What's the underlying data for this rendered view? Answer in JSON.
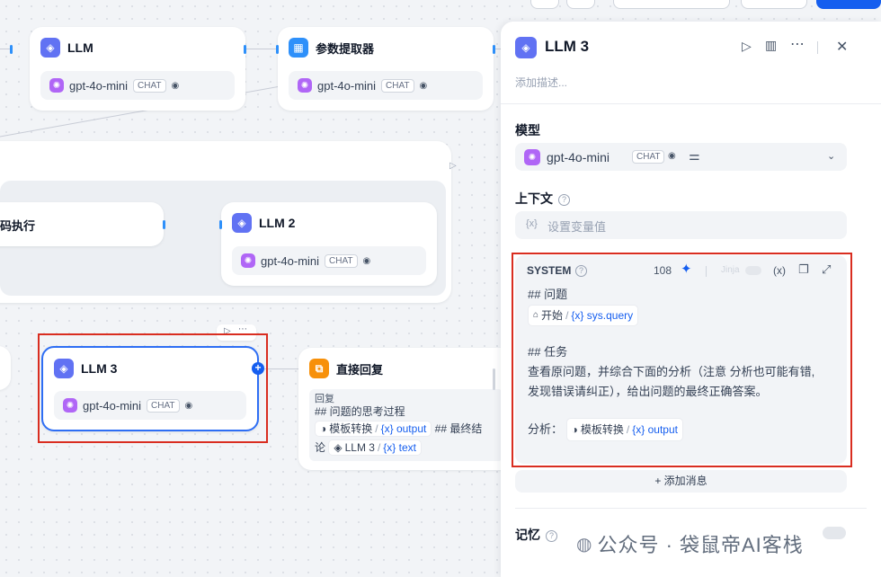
{
  "canvas": {
    "nodes": {
      "llm_top": {
        "title": "LLM",
        "model": "gpt-4o-mini",
        "tag": "CHAT"
      },
      "param": {
        "title": "参数提取器",
        "model": "gpt-4o-mini",
        "tag": "CHAT"
      },
      "code": {
        "title": "码执行"
      },
      "llm2": {
        "title": "LLM 2",
        "model": "gpt-4o-mini",
        "tag": "CHAT"
      },
      "llm3": {
        "title": "LLM 3",
        "model": "gpt-4o-mini",
        "tag": "CHAT"
      },
      "answer": {
        "title": "直接回复",
        "line1": "回复",
        "line2": "## 问题的思考过程",
        "chip1": "模板转换",
        "var1": "{x} output",
        "text_after": "## 最终结",
        "text_wrap": "论",
        "chip2": "LLM 3",
        "var2": "{x} text"
      }
    }
  },
  "panel": {
    "title": "LLM 3",
    "description_placeholder": "添加描述...",
    "model_label": "模型",
    "model": "gpt-4o-mini",
    "model_tag": "CHAT",
    "context_label": "上下文",
    "context_placeholder": "设置变量值",
    "system": {
      "label": "SYSTEM",
      "count": "108",
      "jinja": "Jinja",
      "var_btn": "(x)",
      "line1": "## 问题",
      "chip_start": "开始",
      "chip_query": "{x} sys.query",
      "line2": "## 任务",
      "line3": "查看原问题，并综合下面的分析（注意 分析也可能有错,",
      "line4": "发现错误请纠正），给出问题的最终正确答案。",
      "analysis_label": "分析：",
      "chip_template": "模板转换",
      "chip_output": "{x} output"
    },
    "add_message": "+ 添加消息",
    "memory_label": "记忆"
  },
  "watermark": "公众号 · 袋鼠帝AI客栈"
}
